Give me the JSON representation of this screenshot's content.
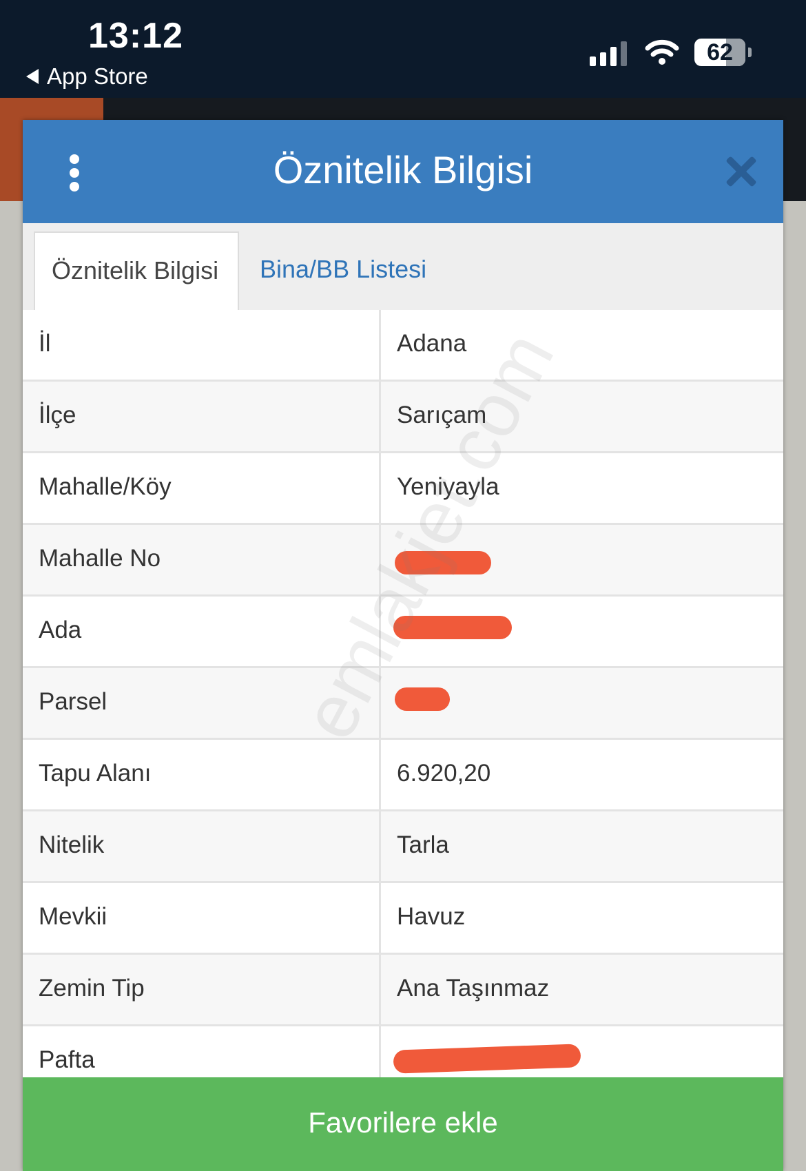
{
  "status_bar": {
    "time": "13:12",
    "back_label": "App Store",
    "battery": "62"
  },
  "modal": {
    "title": "Öznitelik Bilgisi",
    "tabs": [
      {
        "label": "Öznitelik Bilgisi",
        "active": true
      },
      {
        "label": "Bina/BB Listesi",
        "active": false
      }
    ],
    "rows": [
      {
        "key": "İl",
        "value": "Adana"
      },
      {
        "key": "İlçe",
        "value": "Sarıçam"
      },
      {
        "key": "Mahalle/Köy",
        "value": "Yeniyayla"
      },
      {
        "key": "Mahalle No",
        "value": ""
      },
      {
        "key": "Ada",
        "value": ""
      },
      {
        "key": "Parsel",
        "value": ""
      },
      {
        "key": "Tapu Alanı",
        "value": "6.920,20"
      },
      {
        "key": "Nitelik",
        "value": "Tarla"
      },
      {
        "key": "Mevkii",
        "value": "Havuz"
      },
      {
        "key": "Zemin Tip",
        "value": "Ana Taşınmaz"
      },
      {
        "key": "Pafta",
        "value": ""
      }
    ],
    "favorite_button": "Favorilere ekle"
  },
  "watermark": "emlakjet.com",
  "colors": {
    "header": "#3a7dbf",
    "tab_link": "#2f74b8",
    "button": "#5cb85c",
    "redaction": "#f05a3a"
  }
}
